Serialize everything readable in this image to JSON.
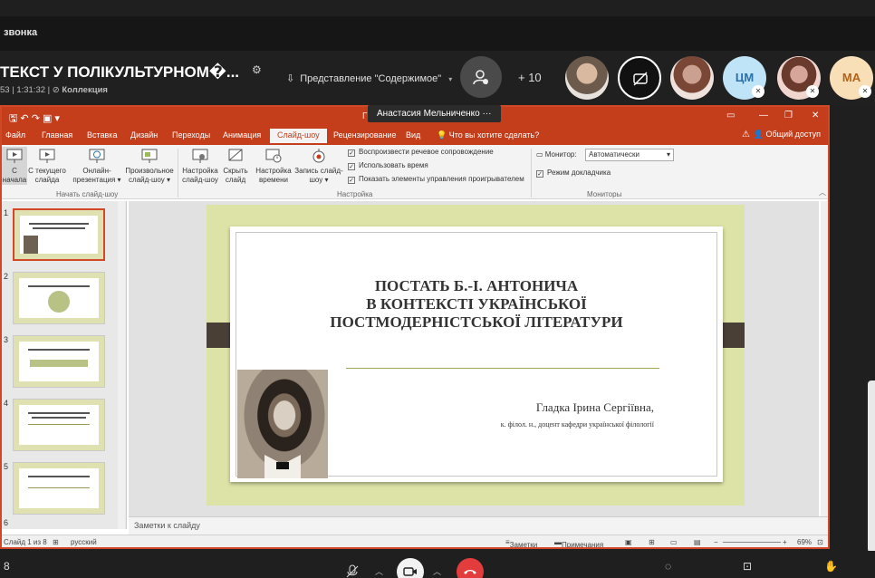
{
  "meeting": {
    "top_label": "звонка",
    "title": "ТЕКСТ У ПОЛІКУЛЬТУРНОМ�...",
    "time": "53 | 1:31:32",
    "collection": "Коллекция",
    "presenting": "Представление \"Содержимое\"",
    "participants_more": "+ 10",
    "presenter_tooltip": "Анастасия Мельниченко ···",
    "avatars": [
      {
        "kind": "photo",
        "initials": ""
      },
      {
        "kind": "camera-off",
        "initials": ""
      },
      {
        "kind": "photo",
        "initials": ""
      },
      {
        "kind": "initials",
        "initials": "ЦМ"
      },
      {
        "kind": "photo",
        "initials": ""
      },
      {
        "kind": "initials",
        "initials": "МА"
      }
    ]
  },
  "ppt": {
    "file_name": "Г",
    "tabs": [
      "Файл",
      "Главная",
      "Вставка",
      "Дизайн",
      "Переходы",
      "Анимация",
      "Слайд-шоу",
      "Рецензирование",
      "Вид",
      "Что вы хотите сделать?"
    ],
    "active_tab": "Слайд-шоу",
    "share": "Общий доступ",
    "ribbon": {
      "start_group": "Начать слайд-шоу",
      "setup_group": "Настройка",
      "monitors_group": "Мониторы",
      "buttons": [
        {
          "line1": "С",
          "line2": "начала"
        },
        {
          "line1": "С текущего",
          "line2": "слайда"
        },
        {
          "line1": "Онлайн-",
          "line2": "презентация ▾"
        },
        {
          "line1": "Произвольное",
          "line2": "слайд-шоу ▾"
        },
        {
          "line1": "Настройка",
          "line2": "слайд-шоу"
        },
        {
          "line1": "Скрыть",
          "line2": "слайд"
        },
        {
          "line1": "Настройка",
          "line2": "времени"
        },
        {
          "line1": "Запись слайд-",
          "line2": "шоу ▾"
        }
      ],
      "checks": [
        "Воспроизвести речевое сопровождение",
        "Использовать время",
        "Показать элементы управления проигрывателем"
      ],
      "monitor_label": "Монитор:",
      "monitor_value": "Автоматически",
      "presenter_mode": "Режим докладчика"
    },
    "thumb_numbers": [
      "1",
      "2",
      "3",
      "4",
      "5",
      "6"
    ],
    "slide": {
      "title_lines": [
        "ПОСТАТЬ Б.-І. АНТОНИЧА",
        "В КОНТЕКСТІ УКРАЇНСЬКОЇ",
        "ПОСТМОДЕРНІСТСЬКОЇ ЛІТЕРАТУРИ"
      ],
      "author": "Гладка Ірина Сергіївна,",
      "author_sub": "к. філол. н., доцент кафедри української філології"
    },
    "notes_placeholder": "Заметки к слайду",
    "status": {
      "slide_info": "Слайд 1 из 8",
      "language": "русский",
      "notes": "Заметки",
      "comments": "Примечания",
      "zoom": "69%"
    }
  },
  "colors": {
    "ppt_accent": "#c43e1c",
    "slide_bg": "#dde3a6",
    "end_call": "#e23c3c"
  }
}
